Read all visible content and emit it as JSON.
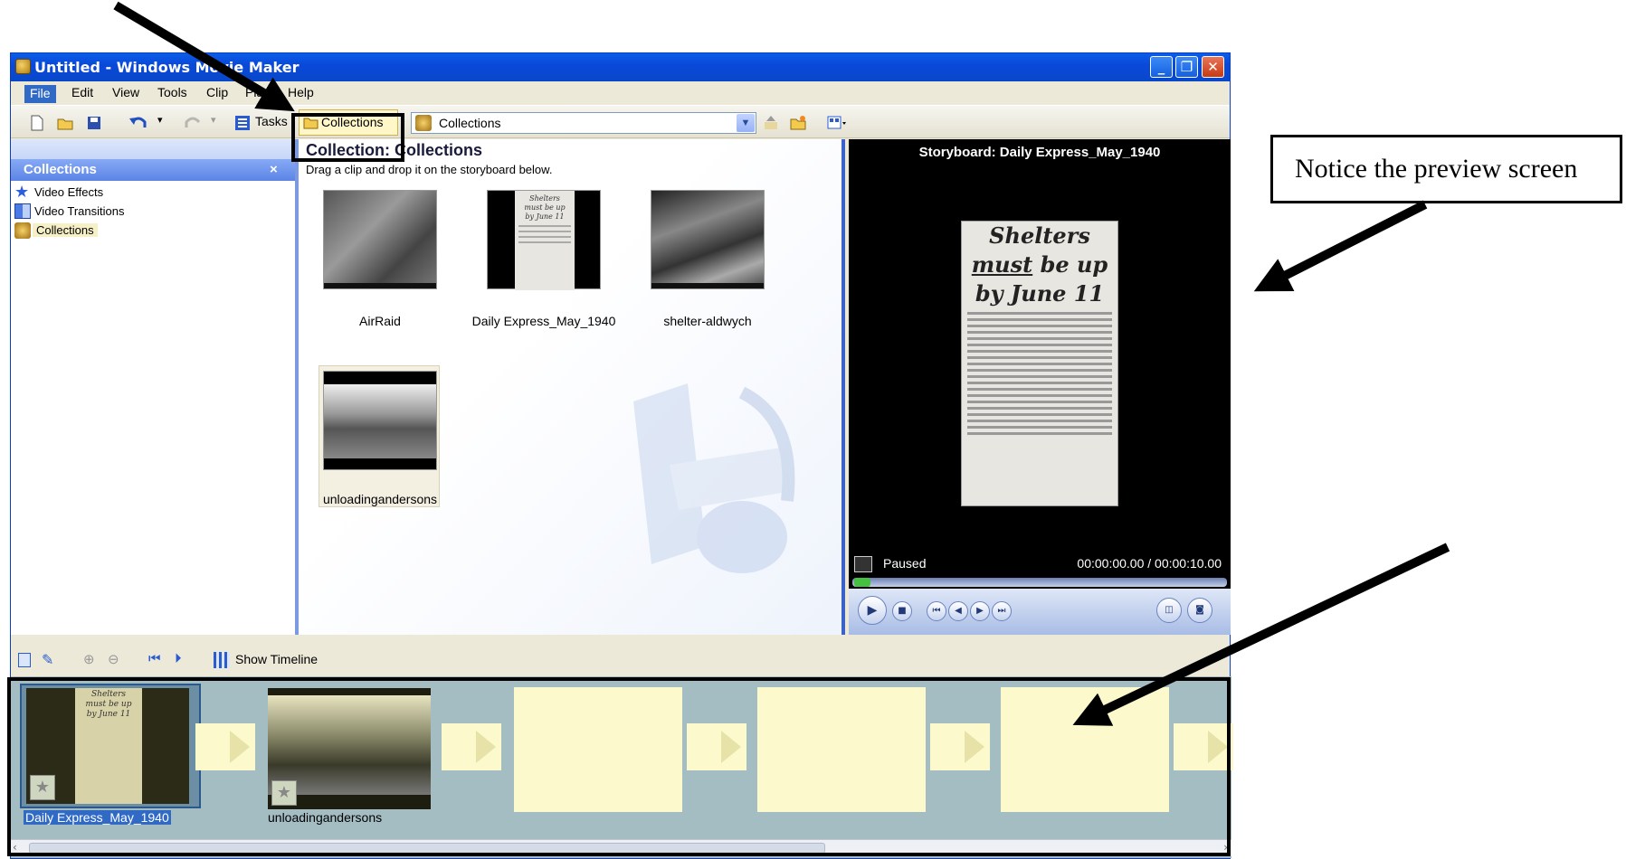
{
  "window": {
    "title": "Untitled - Windows Movie Maker",
    "controls": [
      "minimize",
      "restore",
      "close"
    ]
  },
  "menu": {
    "items": [
      "File",
      "Edit",
      "View",
      "Tools",
      "Clip",
      "Play",
      "Help"
    ]
  },
  "toolbar": {
    "tasks_label": "Tasks",
    "collections_label": "Collections",
    "collections_dropdown_value": "Collections"
  },
  "left_pane": {
    "header": "Collections",
    "close_glyph": "×",
    "items": [
      {
        "label": "Video Effects",
        "icon": "star-icon"
      },
      {
        "label": "Video Transitions",
        "icon": "transition-icon"
      },
      {
        "label": "Collections",
        "icon": "collections-icon"
      }
    ]
  },
  "collection": {
    "title": "Collection: Collections",
    "subtitle": "Drag a clip and drop it on the storyboard below.",
    "clips": [
      {
        "name": "AirRaid"
      },
      {
        "name": "Daily Express_May_1940"
      },
      {
        "name": "shelter-aldwych"
      },
      {
        "name": "unloadingandersons"
      }
    ]
  },
  "preview": {
    "title": "Storyboard: Daily Express_May_1940",
    "status": "Paused",
    "time": "00:00:00.00 / 00:00:10.00",
    "progress": 0,
    "newspaper": {
      "line1": "Shelters",
      "line2a": "must",
      "line2b": " be up",
      "line3": "by June 11"
    }
  },
  "storyboard": {
    "show_timeline_label": "Show Timeline",
    "clips": [
      "Daily Express_May_1940",
      "unloadingandersons"
    ],
    "thumb_text": {
      "l1": "Shelters",
      "l2": "must be up",
      "l3": "by June 11"
    }
  },
  "callout": {
    "text": "Notice the preview screen"
  },
  "colors": {
    "titlebar": "#0a49d9",
    "storyboard_bg": "#a3bdc3",
    "empty_slot": "#fcfacc",
    "collections_highlight": "#fff7c8"
  }
}
